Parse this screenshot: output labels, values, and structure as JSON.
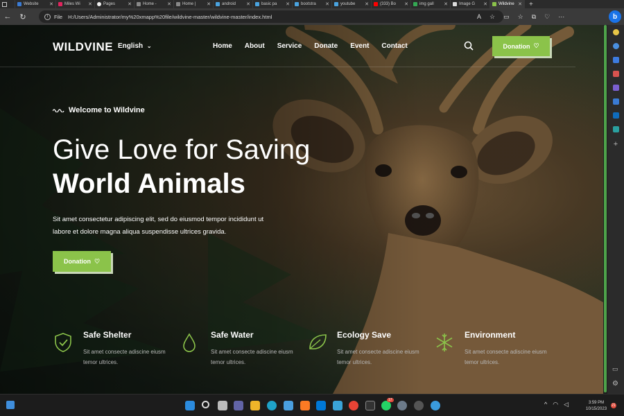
{
  "browser": {
    "tabs": [
      {
        "label": "Website",
        "color": "#3a7bd5"
      },
      {
        "label": "Miles Wi",
        "color": "#e0245e"
      },
      {
        "label": "Pages",
        "color": "#f0f0f0"
      },
      {
        "label": "Home -",
        "color": "#888888"
      },
      {
        "label": "Home |",
        "color": "#888888"
      },
      {
        "label": "android",
        "color": "#4aa3df"
      },
      {
        "label": "basic pa",
        "color": "#4aa3df"
      },
      {
        "label": "bootstra",
        "color": "#4aa3df"
      },
      {
        "label": "youtube",
        "color": "#4aa3df"
      },
      {
        "label": "(333) Bo",
        "color": "#ff0000"
      },
      {
        "label": "img gall",
        "color": "#34a853"
      },
      {
        "label": "Image G",
        "color": "#dddddd"
      },
      {
        "label": "Wildvine",
        "color": "#8bc34a"
      }
    ],
    "url_prefix": "File",
    "url": "H:/Users/Administrator/my%20xmapp%20file/wildvine-master/wildvine-master/index.html",
    "bing_label": "b"
  },
  "site": {
    "logo": "WILDVINE",
    "language": "English",
    "nav": [
      "Home",
      "About",
      "Service",
      "Donate",
      "Event",
      "Contact"
    ],
    "donation_label": "Donation",
    "accent_color": "#8bc34a"
  },
  "hero": {
    "welcome": "Welcome to Wildvine",
    "title_line1": "Give Love for Saving",
    "title_line2": "World Animals",
    "paragraph": "Sit amet consectetur adipiscing elit, sed do eiusmod tempor incididunt ut labore et dolore magna aliqua suspendisse ultrices gravida.",
    "button_label": "Donation"
  },
  "features": [
    {
      "title": "Safe Shelter",
      "desc": "Sit amet consecte adiscine eiusm temor ultrices.",
      "icon": "shield-check-icon"
    },
    {
      "title": "Safe Water",
      "desc": "Sit amet consecte adiscine eiusm temor ultrices.",
      "icon": "water-drop-icon"
    },
    {
      "title": "Ecology Save",
      "desc": "Sit amet consecte adiscine eiusm temor ultrices.",
      "icon": "leaf-icon"
    },
    {
      "title": "Environment",
      "desc": "Sit amet consecte adiscine eiusm temor ultrices.",
      "icon": "snowflake-icon"
    }
  ],
  "taskbar": {
    "time": "3:59 PM",
    "date": "10/15/2023",
    "notifications": "21",
    "whatsapp_badge": "17"
  }
}
